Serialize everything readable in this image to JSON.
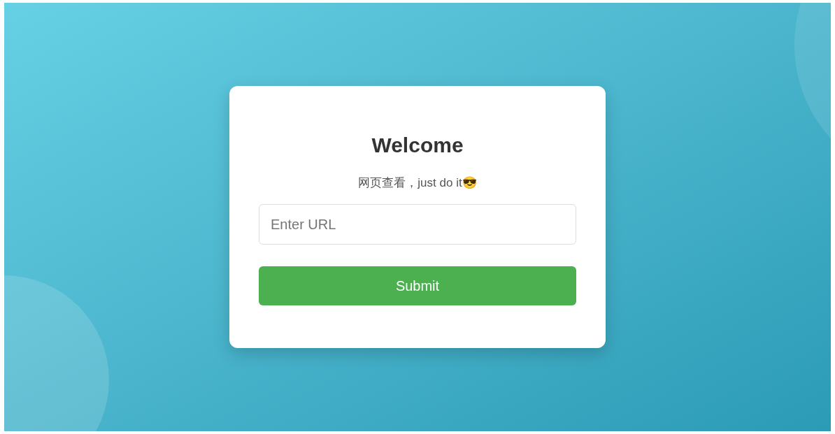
{
  "card": {
    "title": "Welcome",
    "subtitle": "网页查看，just do it😎"
  },
  "url_field": {
    "placeholder": "Enter URL"
  },
  "submit_button": {
    "label": "Submit"
  }
}
